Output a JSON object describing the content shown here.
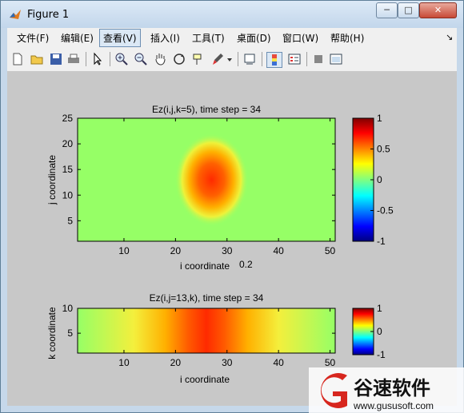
{
  "window": {
    "title": "Figure 1",
    "min_label": "─",
    "max_label": "□",
    "close_label": "✕"
  },
  "menubar": {
    "items": [
      {
        "label": "文件(F)"
      },
      {
        "label": "编辑(E)"
      },
      {
        "label": "查看(V)"
      },
      {
        "label": "插入(I)"
      },
      {
        "label": "工具(T)"
      },
      {
        "label": "桌面(D)"
      },
      {
        "label": "窗口(W)"
      },
      {
        "label": "帮助(H)"
      }
    ],
    "overflow": "↘"
  },
  "toolbar": {
    "icons": [
      "new-file-icon",
      "open-folder-icon",
      "save-icon",
      "print-icon",
      "pointer-icon",
      "zoom-in-icon",
      "zoom-out-icon",
      "pan-hand-icon",
      "rotate-3d-icon",
      "data-cursor-icon",
      "brush-icon",
      "brush-dropdown-icon",
      "link-plot-icon",
      "colorbar-icon",
      "legend-icon",
      "hide-tools-icon",
      "dock-icon"
    ]
  },
  "plot1": {
    "title": "Ez(i,j,k=5), time step = 34",
    "xlabel": "i coordinate",
    "ylabel": "j coordinate",
    "xticks": [
      "10",
      "20",
      "30",
      "40",
      "50"
    ],
    "yticks": [
      "5",
      "10",
      "15",
      "20",
      "25"
    ],
    "cbticks": [
      "1",
      "0.5",
      "0",
      "-0.5",
      "-1"
    ],
    "stray_text": "0.2"
  },
  "plot2": {
    "title": "Ez(i,j=13,k), time step = 34",
    "xlabel": "i coordinate",
    "ylabel": "k coordinate",
    "xticks": [
      "10",
      "20",
      "30",
      "40",
      "50"
    ],
    "yticks": [
      "5",
      "10"
    ],
    "cbticks": [
      "1",
      "0",
      "-1"
    ]
  },
  "watermark": {
    "brand": "谷速软件",
    "url": "www.gususoft.com"
  },
  "chart_data": [
    {
      "type": "heatmap",
      "title": "Ez(i,j,k=5), time step = 34",
      "xlabel": "i coordinate",
      "ylabel": "j coordinate",
      "xlim": [
        1,
        51
      ],
      "ylim": [
        1,
        25
      ],
      "clim": [
        -1,
        1
      ],
      "colormap": "jet",
      "background_value": 0.3,
      "peak": {
        "i": 27,
        "j": 13,
        "value": 0.85
      },
      "colors": {
        "background": "#96ff66",
        "peak": "#ff3300"
      }
    },
    {
      "type": "heatmap",
      "title": "Ez(i,j=13,k), time step = 34",
      "xlabel": "i coordinate",
      "ylabel": "k coordinate",
      "xlim": [
        1,
        51
      ],
      "ylim": [
        1,
        10
      ],
      "clim": [
        -1,
        1
      ],
      "colormap": "jet",
      "background_value": 0.3,
      "peak": {
        "i": 27,
        "value": 0.85
      }
    }
  ]
}
